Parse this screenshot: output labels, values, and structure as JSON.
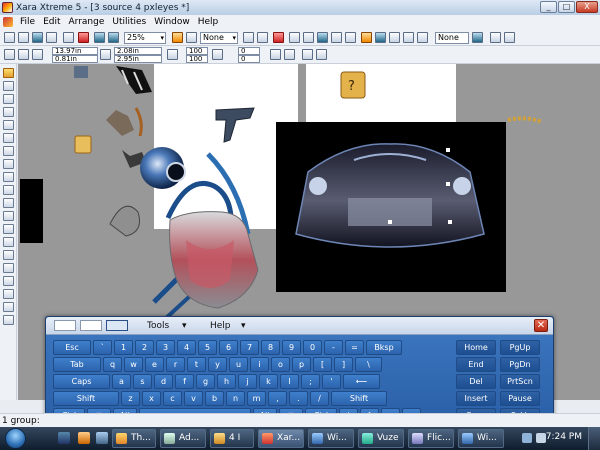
{
  "window": {
    "title": "Xara Xtreme 5 - [3 source 4 pxleyes *]"
  },
  "window_buttons": [
    "_",
    "□",
    "X"
  ],
  "menu": [
    "File",
    "Edit",
    "Arrange",
    "Utilities",
    "Window",
    "Help"
  ],
  "toolbar1": {
    "zoom_value": "25%",
    "fill_value": "None",
    "none_value": "None"
  },
  "toolbar2": {
    "x_value": "13.97in",
    "y_value": "0.81in",
    "w_value": "2.08in",
    "h_value": "2.95in",
    "scale_w": "100",
    "scale_h": "100",
    "angle_value": "0",
    "skew_value": "0"
  },
  "statusbar": {
    "text": "1 group:"
  },
  "osk": {
    "menu_tools": "Tools",
    "menu_help": "Help",
    "rows": [
      [
        "Esc",
        "`",
        "1",
        "2",
        "3",
        "4",
        "5",
        "6",
        "7",
        "8",
        "9",
        "0",
        "-",
        "=",
        "Bksp",
        "Home",
        "PgUp"
      ],
      [
        "Tab",
        "q",
        "w",
        "e",
        "r",
        "t",
        "y",
        "u",
        "i",
        "o",
        "p",
        "[",
        "]",
        "\\",
        "End",
        "PgDn"
      ],
      [
        "Caps",
        "a",
        "s",
        "d",
        "f",
        "g",
        "h",
        "j",
        "k",
        "l",
        ";",
        "'",
        "⟵",
        "Del",
        "PrtScn"
      ],
      [
        "Shift",
        "z",
        "x",
        "c",
        "v",
        "b",
        "n",
        "m",
        ",",
        ".",
        "/",
        "Shift",
        "Insert",
        "Pause"
      ],
      [
        "Ctrl",
        "⊞",
        "Alt",
        "",
        "Alt",
        "⊟",
        "Ctrl",
        "↓",
        "↑",
        "←",
        "→",
        "Func",
        "ScLk"
      ]
    ]
  },
  "taskbar": {
    "buttons": [
      "Th...",
      "Ad...",
      "4 I",
      "Xar...",
      "Wi...",
      "Vuze",
      "Flic...",
      "Wi..."
    ],
    "clock": "7:24 PM"
  },
  "colors": {
    "canvas": "#989898",
    "osk_blue": "#2c63ad",
    "taskbar": "#1a2a3d"
  }
}
